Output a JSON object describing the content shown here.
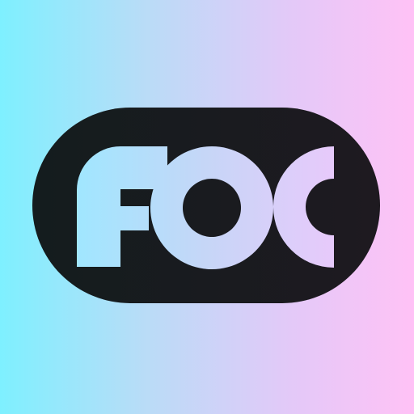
{
  "app_icon": {
    "wordmark": "FOC",
    "colors": {
      "gradient_start": "#7ef0ff",
      "gradient_mid1": "#b9dcf7",
      "gradient_mid2": "#e3c9f8",
      "gradient_end": "#ffc2f6",
      "pill": "#1a1a1e",
      "pill_left": "#141c1e",
      "pill_right": "#1e1a20"
    },
    "icon_name": "foc-logo-icon"
  }
}
